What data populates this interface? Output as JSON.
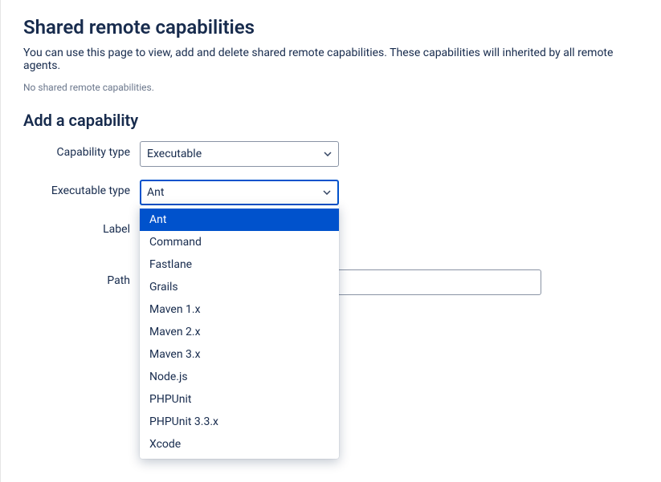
{
  "header": {
    "title": "Shared remote capabilities",
    "description": "You can use this page to view, add and delete shared remote capabilities. These capabilities will inherited by all remote agents.",
    "empty_state": "No shared remote capabilities."
  },
  "form": {
    "section_title": "Add a capability",
    "capability_type": {
      "label": "Capability type",
      "selected": "Executable"
    },
    "executable_type": {
      "label": "Executable type",
      "selected": "Ant",
      "options": [
        "Ant",
        "Command",
        "Fastlane",
        "Grails",
        "Maven 1.x",
        "Maven 2.x",
        "Maven 3.x",
        "Node.js",
        "PHPUnit",
        "PHPUnit 3.3.x",
        "Xcode"
      ]
    },
    "label_field": {
      "label": "Label",
      "value": ""
    },
    "path_field": {
      "label": "Path",
      "value": ""
    }
  }
}
